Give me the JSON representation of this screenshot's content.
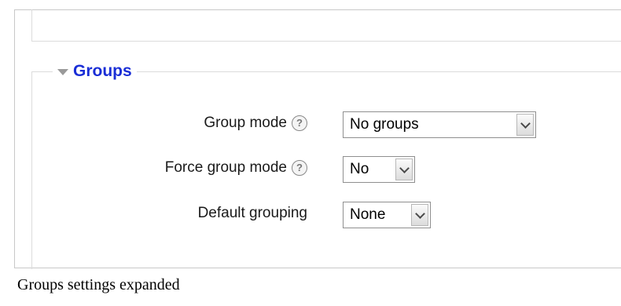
{
  "section": {
    "title": "Groups"
  },
  "fields": [
    {
      "label": "Group mode",
      "value": "No groups",
      "has_help": true
    },
    {
      "label": "Force group mode",
      "value": "No",
      "has_help": true
    },
    {
      "label": "Default grouping",
      "value": "None",
      "has_help": false
    }
  ],
  "help_icon_glyph": "?",
  "caption": "Groups settings expanded",
  "colors": {
    "legend": "#1a2ed6",
    "border": "#c8c8c8",
    "arrow": "#9a9a9a"
  },
  "icons": {
    "collapse": "triangle-down-icon",
    "help": "question-circle-icon",
    "dropdown": "chevron-down-icon"
  }
}
